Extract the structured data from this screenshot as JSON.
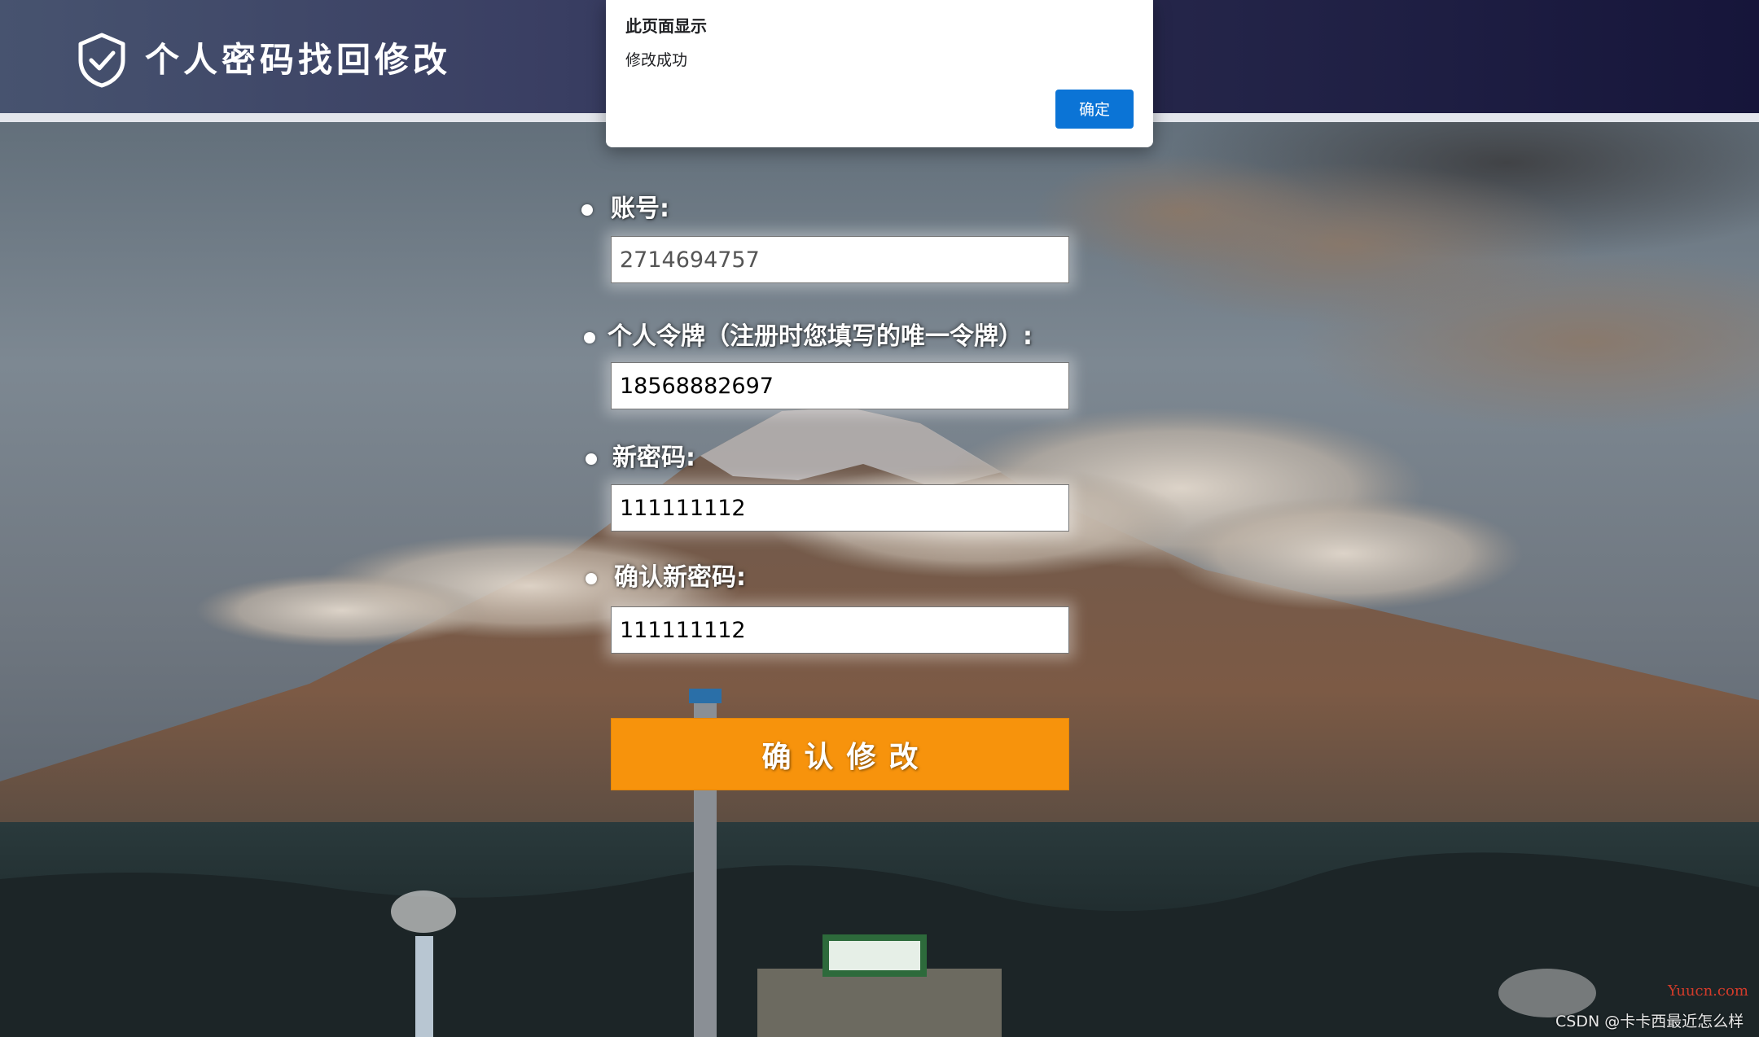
{
  "header": {
    "title": "个人密码找回修改",
    "logo_icon": "shield-check-icon"
  },
  "dialog": {
    "title": "此页面显示",
    "message": "修改成功",
    "ok_label": "确定"
  },
  "form": {
    "fields": [
      {
        "label": "账号:",
        "value": "2714694757"
      },
      {
        "label": "个人令牌（注册时您填写的唯一令牌）:",
        "value": "18568882697"
      },
      {
        "label": "新密码:",
        "value": "111111112"
      },
      {
        "label": "确认新密码:",
        "value": "111111112"
      }
    ],
    "submit_label": "确认修改"
  },
  "watermark": {
    "site": "Yuucn.com",
    "csdn": "CSDN @卡卡西最近怎么样"
  },
  "colors": {
    "header_start": "#47536f",
    "header_end": "#16153a",
    "submit_bg": "#f7930c",
    "dialog_button": "#0b74d6"
  }
}
